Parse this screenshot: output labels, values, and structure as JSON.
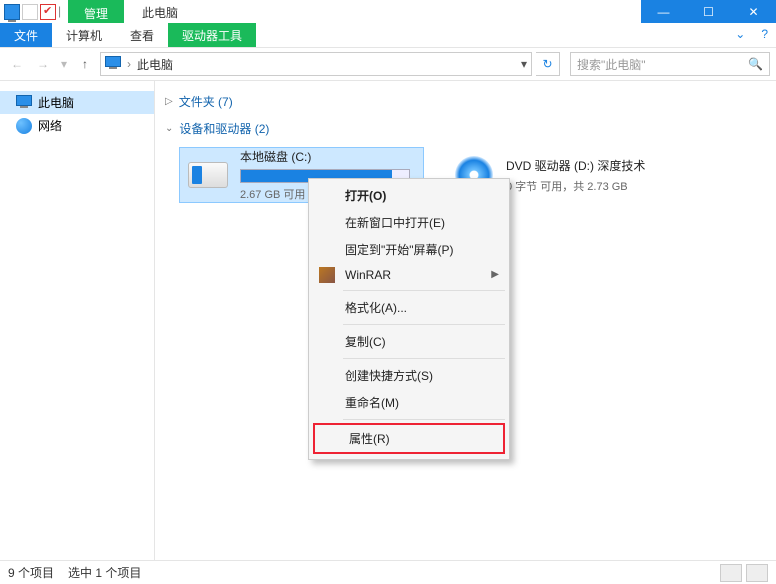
{
  "titlebar": {
    "ribbon_context": "管理",
    "window_title": "此电脑"
  },
  "ribbon": {
    "file": "文件",
    "computer": "计算机",
    "view": "查看",
    "drive_tools": "驱动器工具"
  },
  "navbar": {
    "crumb": "此电脑",
    "search_placeholder": "搜索\"此电脑\""
  },
  "sidebar": {
    "this_pc": "此电脑",
    "network": "网络"
  },
  "groups": {
    "folders_label": "文件夹 (7)",
    "devices_label": "设备和驱动器 (2)"
  },
  "drives": {
    "c": {
      "name": "本地磁盘 (C:)",
      "status": "2.67 GB 可用",
      "fill_percent": 90
    },
    "d": {
      "name": "DVD 驱动器 (D:) 深度技术",
      "status": "0 字节 可用，共 2.73 GB"
    }
  },
  "context_menu": {
    "open": "打开(O)",
    "open_new_window": "在新窗口中打开(E)",
    "pin_start": "固定到\"开始\"屏幕(P)",
    "winrar": "WinRAR",
    "format": "格式化(A)...",
    "copy": "复制(C)",
    "create_shortcut": "创建快捷方式(S)",
    "rename": "重命名(M)",
    "properties": "属性(R)"
  },
  "statusbar": {
    "items": "9 个项目",
    "selected": "选中 1 个项目"
  }
}
